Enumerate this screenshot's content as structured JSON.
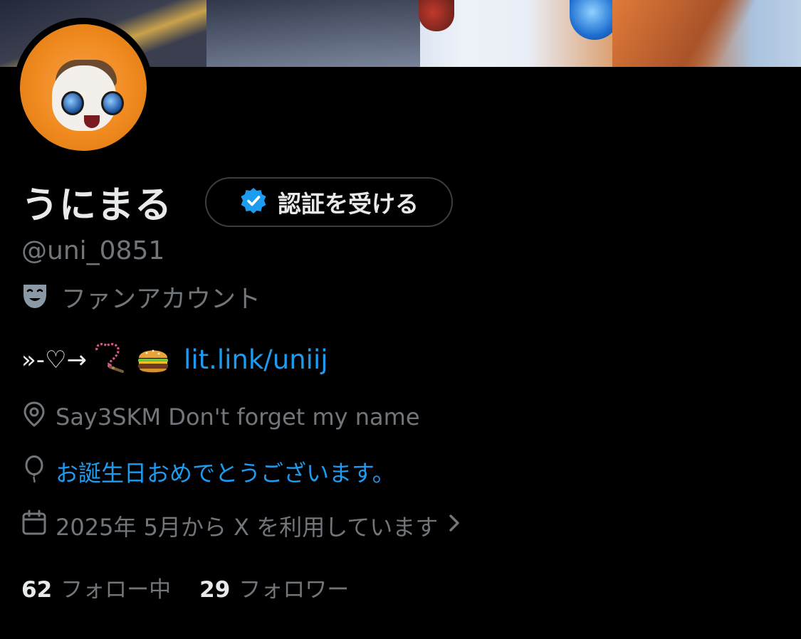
{
  "profile": {
    "display_name": "うにまる",
    "handle": "@uni_0851",
    "category": "ファンアカウント",
    "bio_prefix": "»-♡→",
    "bio_link": "lit.link/uniij",
    "location": "Say3SKM  Don't forget my name",
    "birthday": "お誕生日おめでとうございます。",
    "joined": "2025年 5月から X を利用しています",
    "following_count": "62",
    "following_label": "フォロー中",
    "followers_count": "29",
    "followers_label": "フォロワー"
  },
  "actions": {
    "get_verified_label": "認証を受ける"
  },
  "colors": {
    "background": "#000000",
    "text_primary": "#e7e9ea",
    "text_secondary": "#71767b",
    "accent_blue": "#1d9bf0",
    "button_border": "#3a3e44"
  },
  "icons": {
    "verified": "verified-badge-icon",
    "category": "theater-masks-icon",
    "location": "location-pin-icon",
    "birthday": "balloon-icon",
    "joined": "calendar-icon",
    "chevron": "chevron-right-icon"
  }
}
